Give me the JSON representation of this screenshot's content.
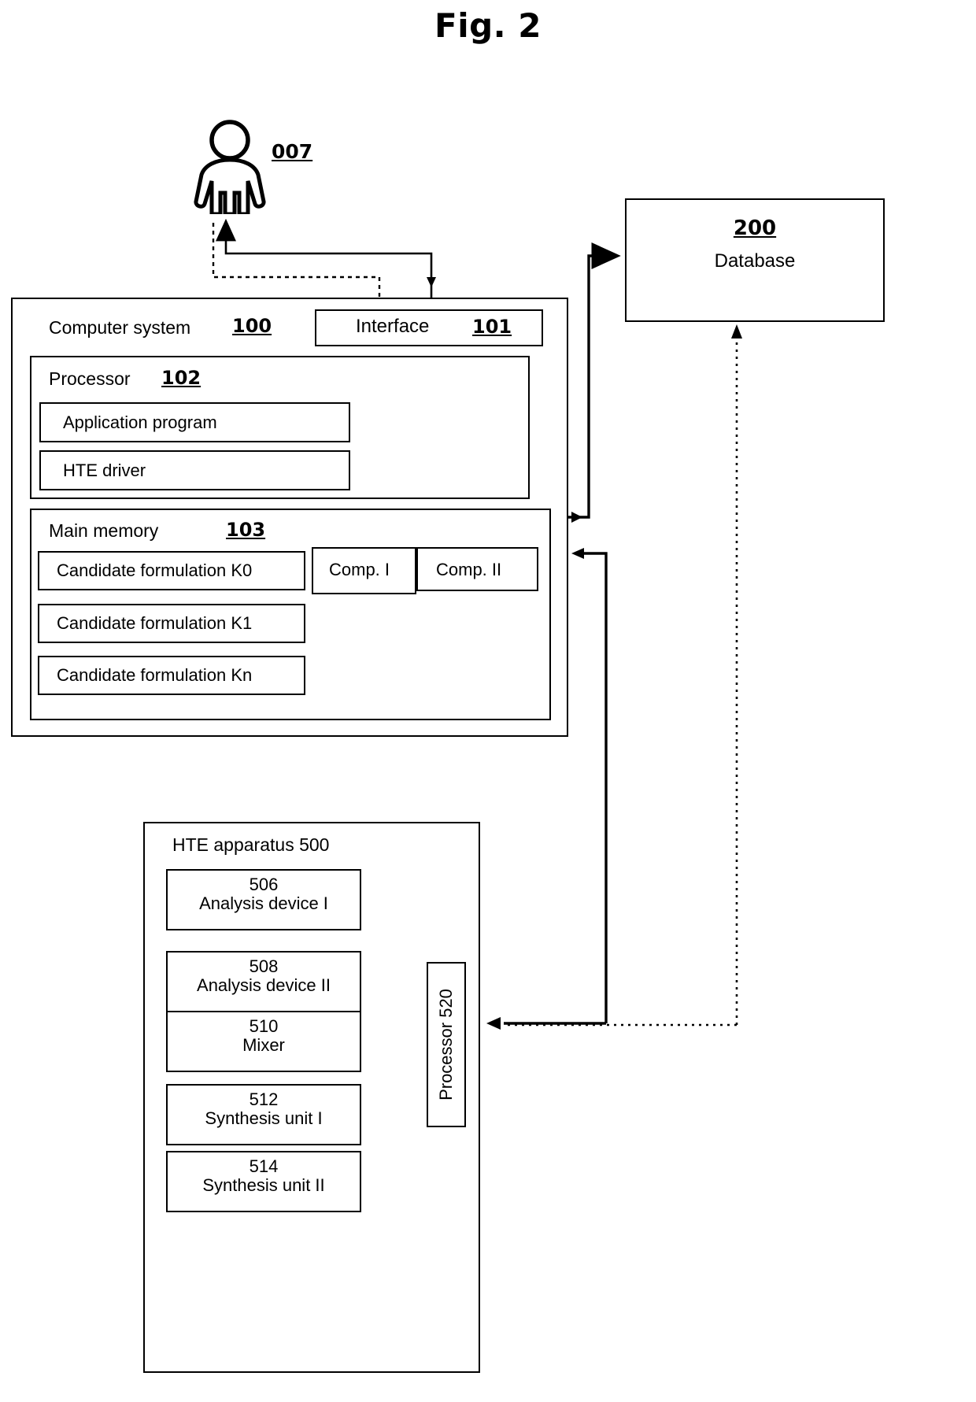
{
  "figure": {
    "title": "Fig. 2"
  },
  "actor": {
    "icon": "person-icon",
    "ref": "007"
  },
  "computer_system": {
    "title": "Computer system",
    "ref": "100",
    "interface": {
      "label": "Interface",
      "ref": "101"
    },
    "processor": {
      "title": "Processor",
      "ref": "102",
      "modules": [
        {
          "label": "Application program"
        },
        {
          "label": "HTE driver"
        }
      ]
    },
    "main_memory": {
      "title": "Main memory",
      "ref": "103",
      "formulations": [
        {
          "label": "Candidate formulation K0"
        },
        {
          "label": "Candidate formulation K1"
        },
        {
          "label": "Candidate formulation Kn"
        }
      ],
      "components": [
        {
          "label": "Comp. I"
        },
        {
          "label": "Comp. II"
        }
      ]
    }
  },
  "database": {
    "ref": "200",
    "label": "Database"
  },
  "hte_apparatus": {
    "title": "HTE apparatus 500",
    "ref": "500",
    "devices": [
      {
        "ref": "506",
        "label": "Analysis device I"
      },
      {
        "ref": "508",
        "label": "Analysis device II"
      },
      {
        "ref": "510",
        "label": "Mixer"
      },
      {
        "ref": "512",
        "label": "Synthesis unit I"
      },
      {
        "ref": "514",
        "label": "Synthesis unit II"
      }
    ],
    "processor": {
      "label": "Processor 520",
      "ref": "520"
    }
  },
  "colors": {
    "line": "#000000",
    "background": "#ffffff"
  }
}
